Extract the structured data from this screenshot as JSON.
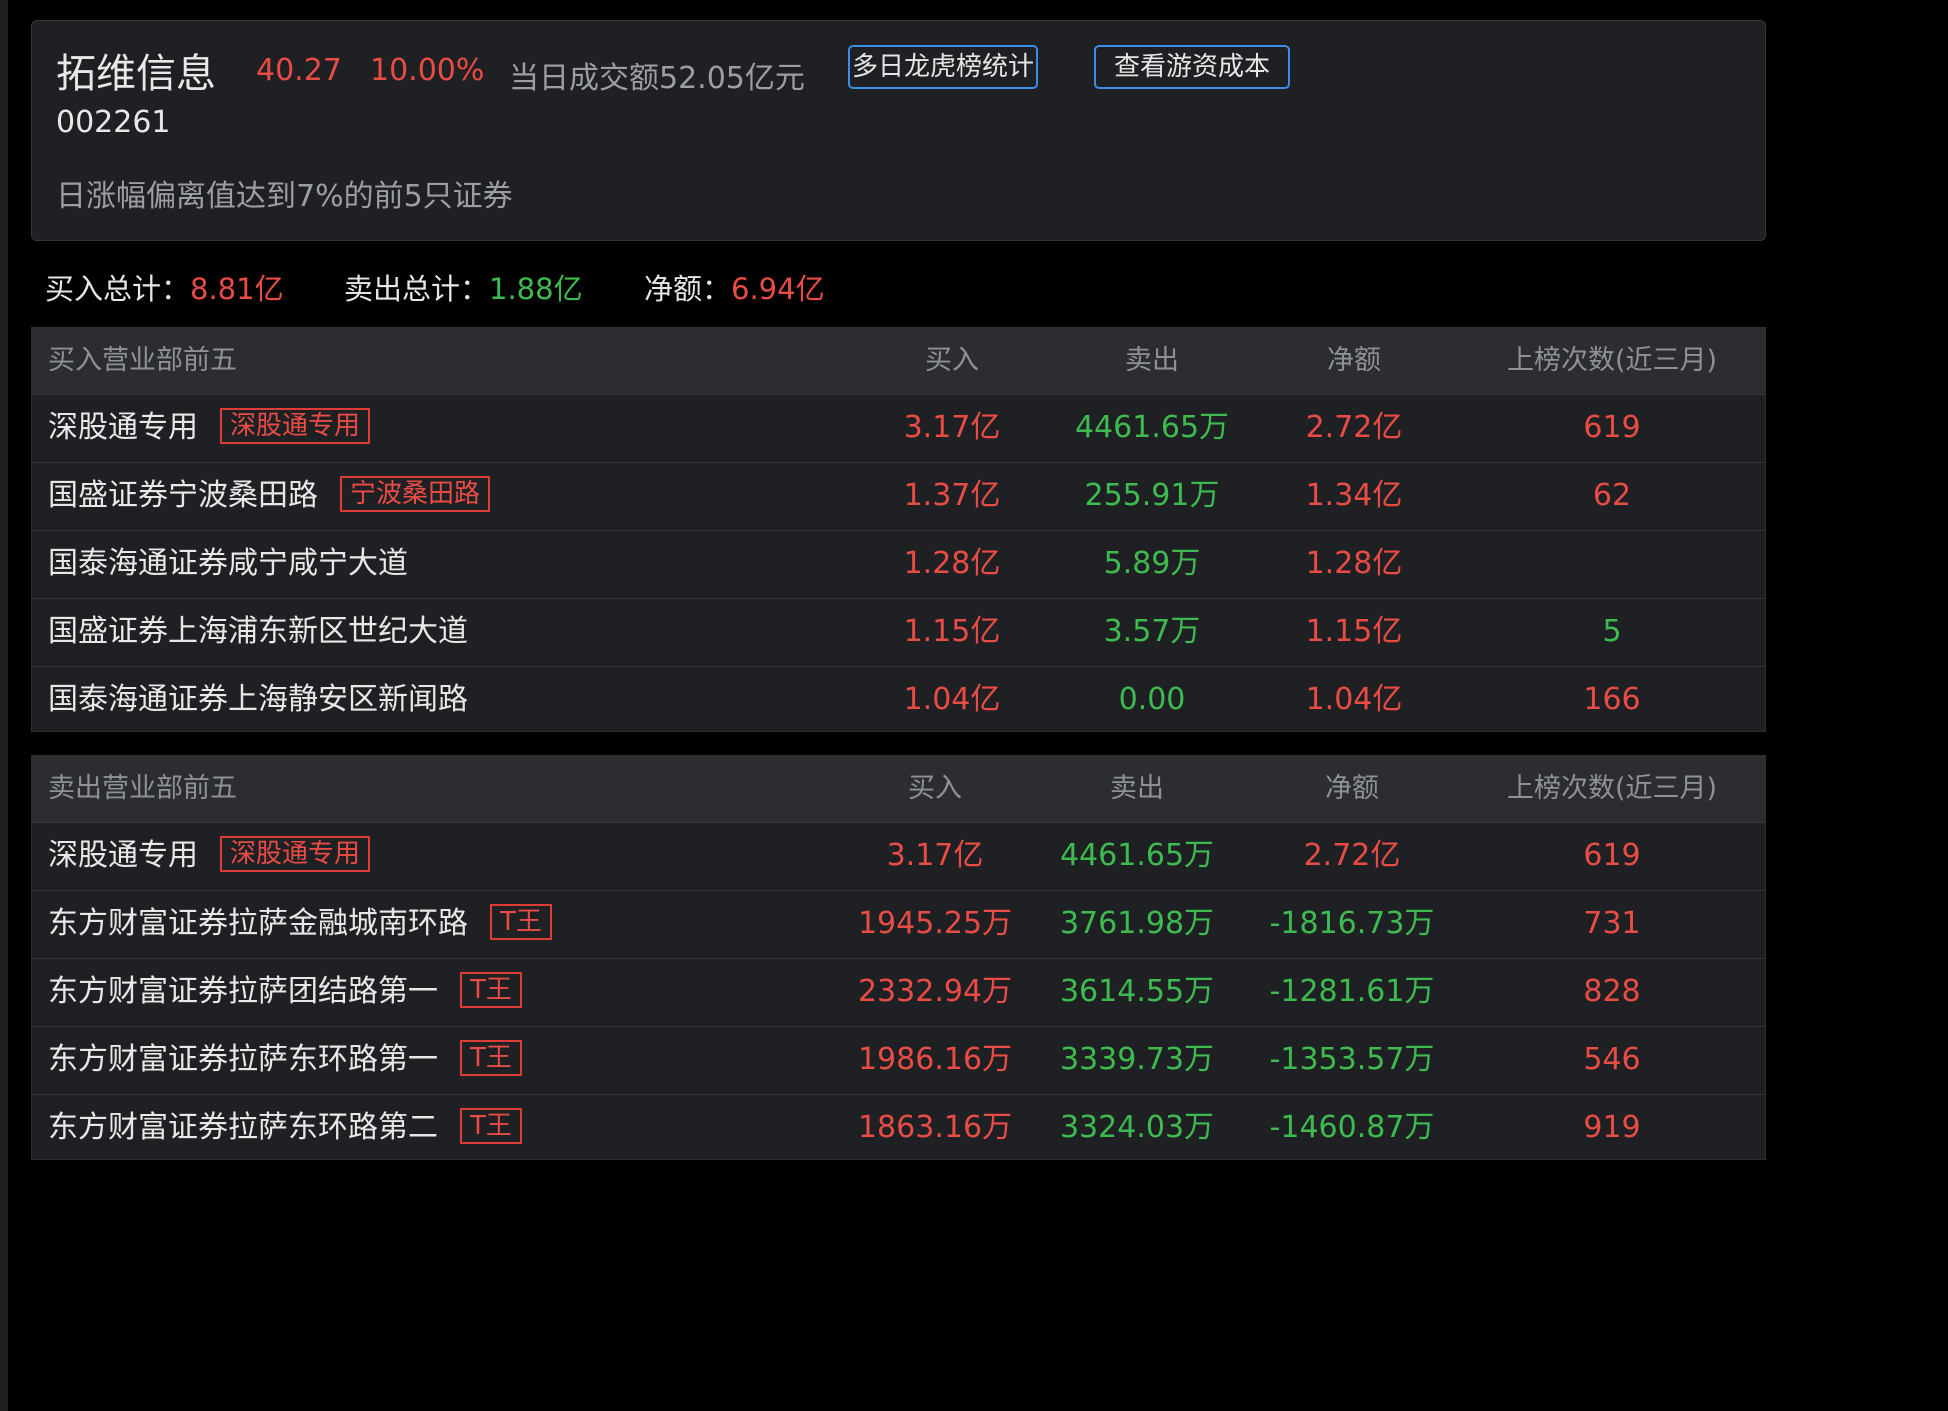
{
  "stock": {
    "name": "拓维信息",
    "price": "40.27",
    "change_pct": "10.00%",
    "turnover": "当日成交额52.05亿元",
    "code": "002261",
    "reason": "日涨幅偏离值达到7%的前5只证券",
    "buttons": {
      "multi_day": "多日龙虎榜统计",
      "hot_money_cost": "查看游资成本"
    }
  },
  "summary": {
    "buy_label": "买入总计：",
    "buy_value": "8.81亿",
    "sell_label": "卖出总计：",
    "sell_value": "1.88亿",
    "net_label": "净额：",
    "net_value": "6.94亿"
  },
  "buy_table": {
    "headers": [
      "买入营业部前五",
      "买入",
      "卖出",
      "净额",
      "上榜次数(近三月)"
    ],
    "rows": [
      {
        "name": "深股通专用",
        "tag": "深股通专用",
        "buy": "3.17亿",
        "sell": "4461.65万",
        "net": "2.72亿",
        "count": "619",
        "count_color": "red"
      },
      {
        "name": "国盛证券宁波桑田路",
        "tag": "宁波桑田路",
        "buy": "1.37亿",
        "sell": "255.91万",
        "net": "1.34亿",
        "count": "62",
        "count_color": "red"
      },
      {
        "name": "国泰海通证券咸宁咸宁大道",
        "tag": "",
        "buy": "1.28亿",
        "sell": "5.89万",
        "net": "1.28亿",
        "count": "",
        "count_color": "red"
      },
      {
        "name": "国盛证券上海浦东新区世纪大道",
        "tag": "",
        "buy": "1.15亿",
        "sell": "3.57万",
        "net": "1.15亿",
        "count": "5",
        "count_color": "green"
      },
      {
        "name": "国泰海通证券上海静安区新闻路",
        "tag": "",
        "buy": "1.04亿",
        "sell": "0.00",
        "net": "1.04亿",
        "count": "166",
        "count_color": "red"
      }
    ]
  },
  "sell_table": {
    "headers": [
      "卖出营业部前五",
      "买入",
      "卖出",
      "净额",
      "上榜次数(近三月)"
    ],
    "rows": [
      {
        "name": "深股通专用",
        "tag": "深股通专用",
        "buy": "3.17亿",
        "sell": "4461.65万",
        "net": "2.72亿",
        "net_color": "red",
        "count": "619"
      },
      {
        "name": "东方财富证券拉萨金融城南环路",
        "tag": "T王",
        "buy": "1945.25万",
        "sell": "3761.98万",
        "net": "-1816.73万",
        "net_color": "green",
        "count": "731"
      },
      {
        "name": "东方财富证券拉萨团结路第一",
        "tag": "T王",
        "buy": "2332.94万",
        "sell": "3614.55万",
        "net": "-1281.61万",
        "net_color": "green",
        "count": "828"
      },
      {
        "name": "东方财富证券拉萨东环路第一",
        "tag": "T王",
        "buy": "1986.16万",
        "sell": "3339.73万",
        "net": "-1353.57万",
        "net_color": "green",
        "count": "546"
      },
      {
        "name": "东方财富证券拉萨东环路第二",
        "tag": "T王",
        "buy": "1863.16万",
        "sell": "3324.03万",
        "net": "-1460.87万",
        "net_color": "green",
        "count": "919"
      }
    ]
  },
  "colors": {
    "up": "#e84c45",
    "down": "#3dbb4e",
    "accent": "#3a8ee6"
  }
}
